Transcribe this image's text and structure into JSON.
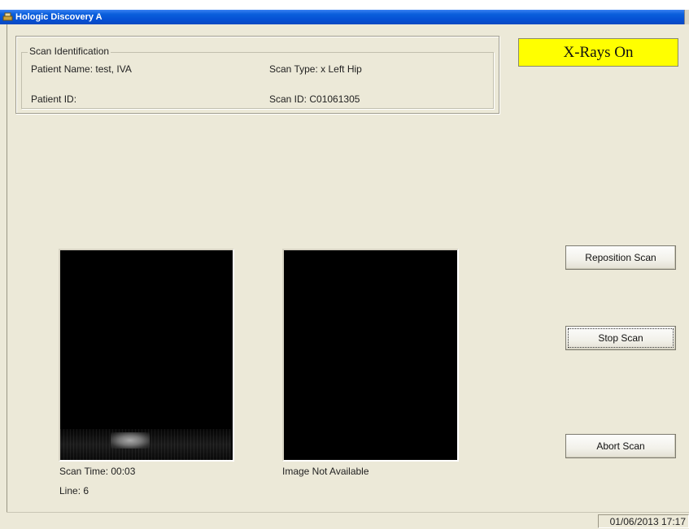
{
  "window": {
    "title": "Hologic Discovery A"
  },
  "scan_identification": {
    "legend": "Scan Identification",
    "patient_name": "Patient Name: test, IVA",
    "patient_id": "Patient ID:",
    "scan_type": "Scan Type: x Left Hip",
    "scan_id": "Scan ID: C01061305"
  },
  "status": {
    "xrays": "X-Rays On",
    "xrays_color": "#ffff00"
  },
  "images": {
    "left_caption": "Scan Time: 00:03",
    "left_line": "Line: 6",
    "right_caption": "Image Not Available"
  },
  "buttons": {
    "reposition": "Reposition Scan",
    "stop": "Stop Scan",
    "abort": "Abort Scan"
  },
  "statusbar": {
    "datetime": "01/06/2013 17:17"
  }
}
